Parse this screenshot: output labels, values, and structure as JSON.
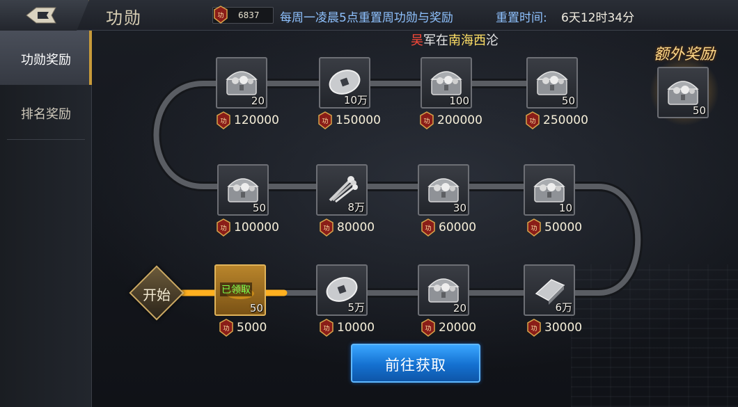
{
  "header": {
    "title": "功勋",
    "merit_icon_text": "功",
    "merit_count": "6837",
    "weekly_note": "每周一凌晨5点重置周功勋与奖励",
    "reset_label": "重置时间:",
    "reset_value": "6天12时34分"
  },
  "marquee": {
    "part1": "吴",
    "part2": "军在",
    "part3": "南海西",
    "part4": "沦"
  },
  "sidebar": {
    "tabs": [
      {
        "label": "功勋奖励",
        "active": true
      },
      {
        "label": "排名奖励",
        "active": false
      }
    ]
  },
  "start_label": "开始",
  "extra_reward": {
    "label": "额外奖励",
    "icon": "silver-chest-icon",
    "qty": "50"
  },
  "rewards": [
    {
      "icon": "silver-chest-icon",
      "qty": "20",
      "cost": "120000",
      "claimed": false
    },
    {
      "icon": "copper-coin-icon",
      "qty": "10万",
      "cost": "150000",
      "claimed": false
    },
    {
      "icon": "silver-chest-icon",
      "qty": "100",
      "cost": "200000",
      "claimed": false
    },
    {
      "icon": "silver-chest-icon",
      "qty": "50",
      "cost": "250000",
      "claimed": false
    },
    {
      "icon": "silver-chest-icon",
      "qty": "50",
      "cost": "100000",
      "claimed": false
    },
    {
      "icon": "grain-bundle-icon",
      "qty": "8万",
      "cost": "80000",
      "claimed": false
    },
    {
      "icon": "silver-chest-icon",
      "qty": "30",
      "cost": "60000",
      "claimed": false
    },
    {
      "icon": "silver-chest-icon",
      "qty": "10",
      "cost": "50000",
      "claimed": false
    },
    {
      "icon": "gold-ingot-icon",
      "qty": "50",
      "cost": "5000",
      "claimed": true,
      "claimed_label": "已领取"
    },
    {
      "icon": "copper-coin-icon",
      "qty": "5万",
      "cost": "10000",
      "claimed": false
    },
    {
      "icon": "silver-chest-icon",
      "qty": "20",
      "cost": "20000",
      "claimed": false
    },
    {
      "icon": "silver-bar-icon",
      "qty": "6万",
      "cost": "30000",
      "claimed": false
    }
  ],
  "go_button": {
    "label": "前往获取"
  },
  "colors": {
    "accent_blue": "#8fc2ff",
    "button_blue": "#1470d0",
    "gold": "#c79a3a",
    "claimed_green": "#7cff4a"
  }
}
